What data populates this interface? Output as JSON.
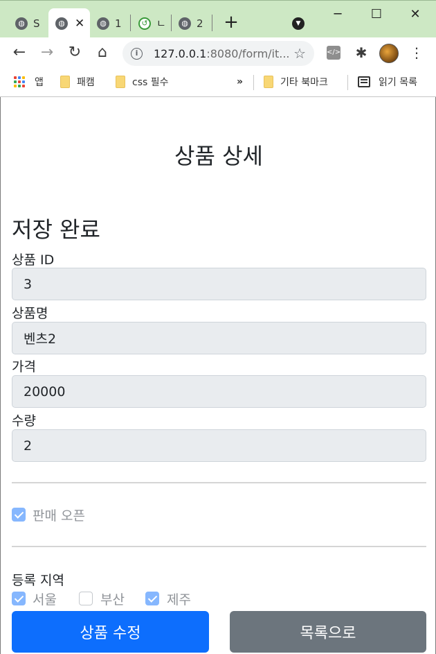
{
  "browser": {
    "tabs": [
      {
        "title": "S",
        "close": ""
      },
      {
        "title": "",
        "close": "✕"
      },
      {
        "title": "1",
        "close": ""
      },
      {
        "title": "ㄴ",
        "close": ""
      },
      {
        "title": "2",
        "close": ""
      }
    ],
    "new_tab": "+",
    "window": {
      "minimize": "─",
      "maximize": "☐",
      "close": "✕"
    },
    "url_host": "127.0.0.1",
    "url_rest": ":8080/form/it...",
    "bookmarks": [
      {
        "label": "앱"
      },
      {
        "label": "패캠"
      },
      {
        "label": "css 필수"
      },
      {
        "label": "기타 북마크"
      },
      {
        "label": "읽기 목록"
      }
    ],
    "overflow": "»"
  },
  "page": {
    "title": "상품 상세",
    "status_message": "저장 완료",
    "fields": [
      {
        "label": "상품 ID",
        "value": "3"
      },
      {
        "label": "상품명",
        "value": "벤츠2"
      },
      {
        "label": "가격",
        "value": "20000"
      },
      {
        "label": "수량",
        "value": "2"
      }
    ],
    "open_label": "판매 오픈",
    "open_checked": true,
    "regions_label": "등록 지역",
    "regions": [
      {
        "label": "서울",
        "checked": true
      },
      {
        "label": "부산",
        "checked": false
      },
      {
        "label": "제주",
        "checked": true
      }
    ],
    "buttons": {
      "edit": "상품 수정",
      "list": "목록으로"
    }
  },
  "colors": {
    "primary": "#0d6efd",
    "secondary": "#6c757d",
    "checkbox_checked": "#86b7fe",
    "input_bg": "#e9ecef",
    "tabstrip_bg": "#cde8c4"
  }
}
